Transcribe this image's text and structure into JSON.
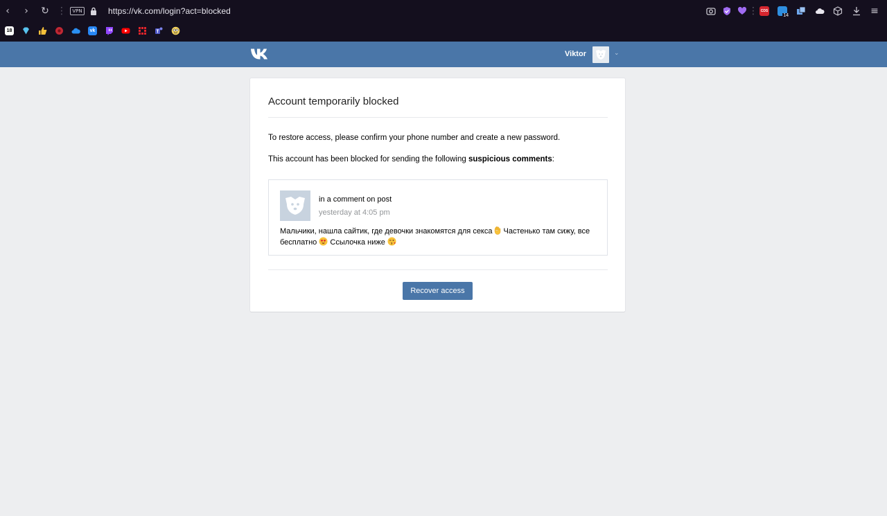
{
  "browser": {
    "url": "https://vk.com/login?act=blocked",
    "vpn_label": "VPN",
    "bookmark_number_label": "18",
    "extension_badge_label": "CDS",
    "extension_count": "14"
  },
  "header": {
    "user_name": "Viktor"
  },
  "card": {
    "title": "Account temporarily blocked",
    "paragraph1": "To restore access, please confirm your phone number and create a new password.",
    "paragraph2_prefix": "This account has been blocked for sending the following ",
    "paragraph2_bold": "suspicious comments",
    "paragraph2_suffix": ":",
    "comment": {
      "context": "in a comment on post",
      "time": "yesterday at 4:05 pm",
      "text_part1": "Мальчики, нашла сайтик, где девочки знакомятся для секса",
      "text_part2": " Частенько там сижу, все бесплатно ",
      "text_part3": " Ссылочка ниже "
    },
    "recover_button": "Recover access"
  },
  "colors": {
    "vk_blue": "#4a76a8",
    "browser_bg": "#140f1e",
    "page_bg": "#edeef0"
  }
}
